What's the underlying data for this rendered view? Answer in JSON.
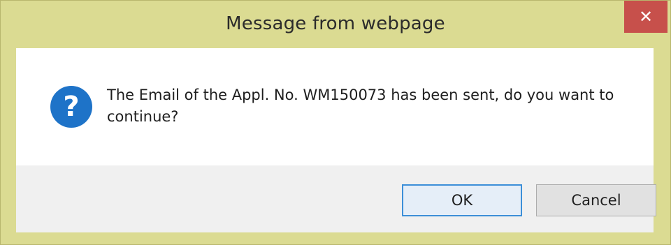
{
  "window": {
    "title": "Message from webpage",
    "close_glyph": "✕"
  },
  "dialog": {
    "icon": "question-icon",
    "icon_color": "#1e73c8",
    "message_line1": "The Email of the Appl. No. WM150073 has been sent, do you want to",
    "message_line2": "continue?"
  },
  "buttons": {
    "ok_label": "OK",
    "cancel_label": "Cancel"
  },
  "colors": {
    "frame": "#dbdb92",
    "close_button": "#c7504b",
    "default_button_border": "#3c8fd8"
  }
}
